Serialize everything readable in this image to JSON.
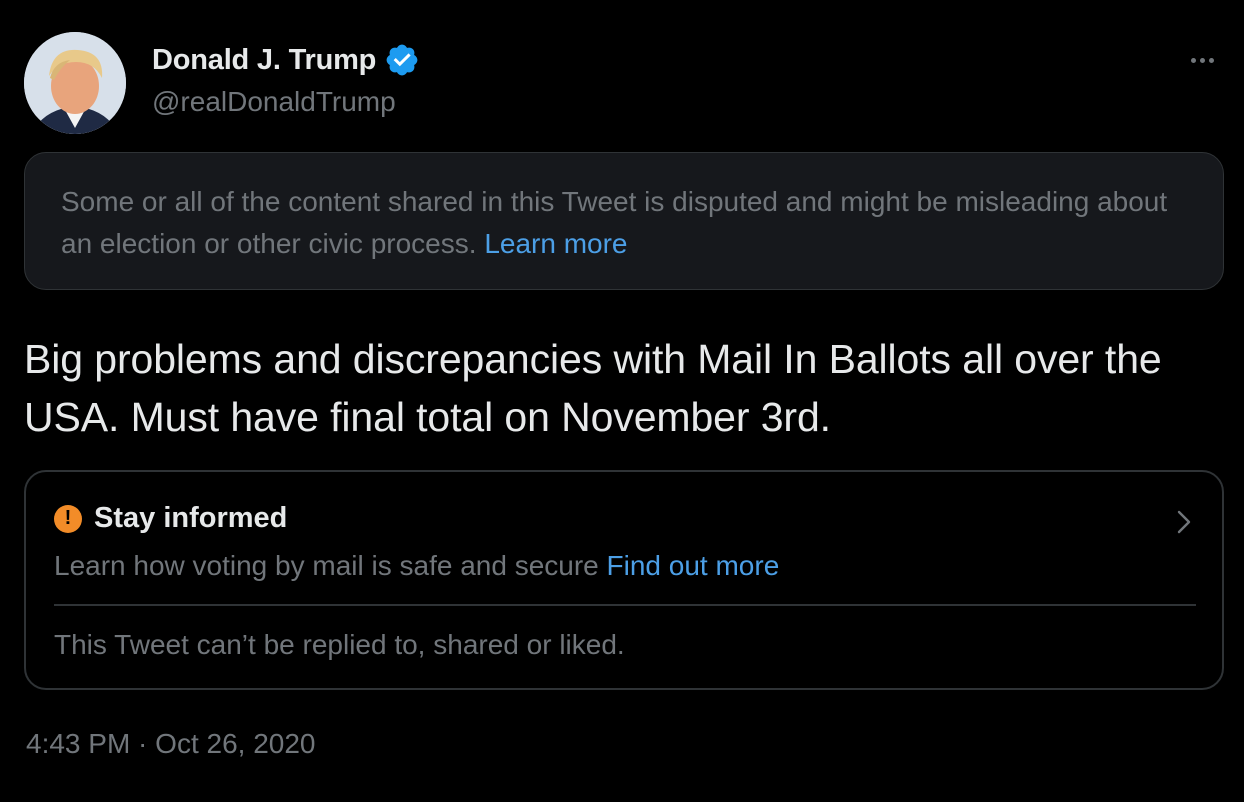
{
  "tweet": {
    "author": {
      "display_name": "Donald J. Trump",
      "handle": "@realDonaldTrump",
      "verified": true,
      "verified_icon": "verified-badge-icon"
    },
    "more_icon": "more-options-icon",
    "dispute_notice": {
      "text": "Some or all of the content shared in this Tweet is disputed and might be misleading about an election or other civic process.",
      "link": "Learn more"
    },
    "body": "Big problems and discrepancies with Mail In Ballots all over the USA. Must have final total on November 3rd.",
    "info_card": {
      "icon": "alert-icon",
      "title": "Stay informed",
      "description": "Learn how voting by mail is safe and secure",
      "link": "Find out more",
      "footer": "This Tweet can’t be replied to, shared or liked."
    },
    "timestamp": "4:43 PM · Oct 26, 2020"
  },
  "colors": {
    "background": "#000000",
    "primary_text": "#e7e9ea",
    "secondary_text": "#71767b",
    "link": "#4c9fe6",
    "verified": "#1d9bf0",
    "alert": "#f28c28",
    "border": "#2f3336"
  }
}
